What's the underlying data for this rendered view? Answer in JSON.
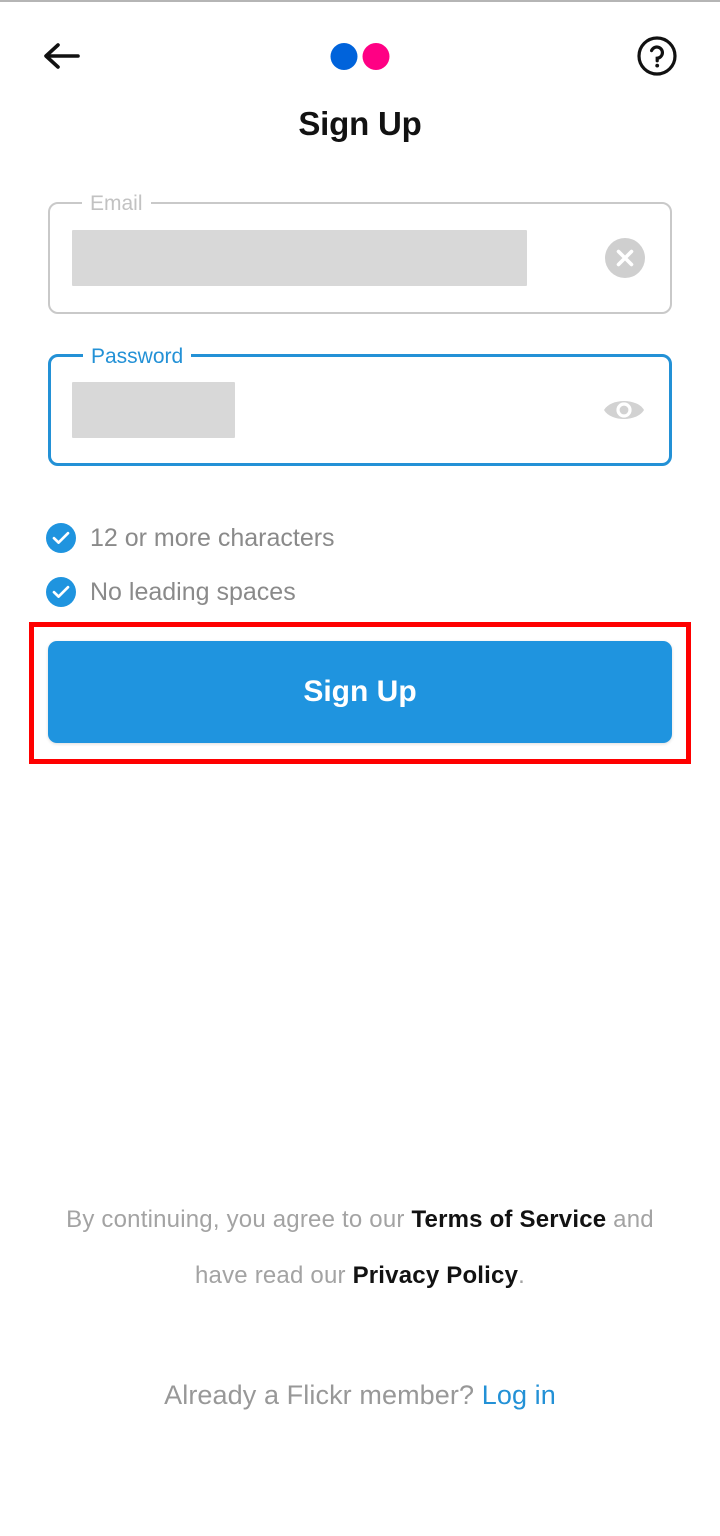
{
  "header": {
    "back_icon": "arrow-left-icon",
    "help_icon": "question-circle-icon",
    "logo": {
      "name": "flickr-logo",
      "dot_blue": "#0063DB",
      "dot_pink": "#FF0084"
    }
  },
  "page": {
    "title": "Sign Up"
  },
  "form": {
    "email": {
      "label": "Email",
      "value": "",
      "placeholder": "Email",
      "redacted": true,
      "focused": false,
      "clear_icon": "clear-circle-icon"
    },
    "password": {
      "label": "Password",
      "value": "",
      "placeholder": "Password",
      "redacted": true,
      "focused": true,
      "visibility_icon": "eye-icon"
    }
  },
  "password_rules": [
    {
      "text": "12 or more characters",
      "satisfied": true,
      "icon": "check-circle-icon"
    },
    {
      "text": "No leading spaces",
      "satisfied": true,
      "icon": "check-circle-icon"
    }
  ],
  "primary_action": {
    "label": "Sign Up",
    "color": "#1F94DF",
    "highlighted": true,
    "highlight_color": "#FE0000"
  },
  "legal": {
    "prefix": "By continuing, you agree to our ",
    "terms_link": "Terms of Service",
    "middle": " and have read our ",
    "privacy_link": "Privacy Policy",
    "suffix": "."
  },
  "login_prompt": {
    "text": "Already a Flickr member?",
    "link": "Log in"
  },
  "colors": {
    "accent_blue": "#1F94DF",
    "focus_blue": "#2391D6",
    "link_blue": "#2391D6",
    "muted_gray": "#8A8A8A",
    "redaction_gray": "#D8D8D8",
    "border_gray": "#C9C9C9"
  }
}
